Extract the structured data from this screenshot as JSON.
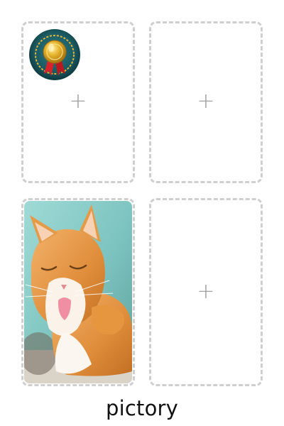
{
  "slots": [
    {
      "name": "slot-1",
      "plus": "+",
      "icon": "medal-badge-icon"
    },
    {
      "name": "slot-2",
      "plus": "+"
    },
    {
      "name": "slot-3",
      "image": "cat-photo"
    },
    {
      "name": "slot-4",
      "plus": "+"
    }
  ],
  "caption": "pictory",
  "colors": {
    "border": "#cfcfcf",
    "plus": "#a2a2a2",
    "badge_ring": "#1f5b63",
    "badge_gold": "#d4a82a",
    "ribbon": "#d8232a"
  }
}
